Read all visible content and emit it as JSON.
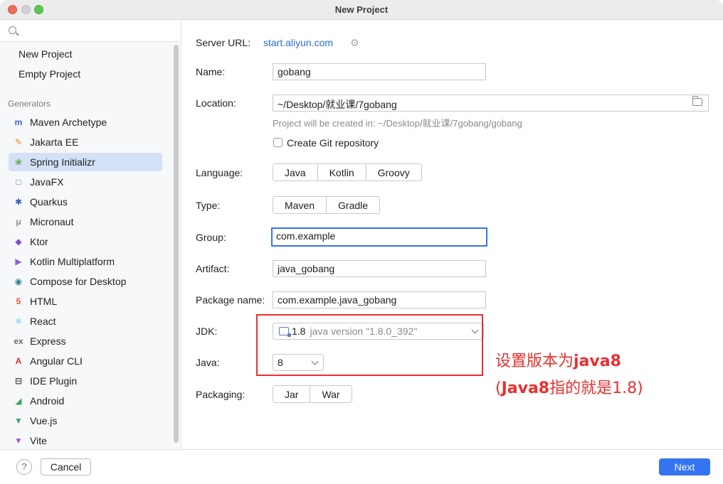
{
  "window": {
    "title": "New Project"
  },
  "sidebar": {
    "search_placeholder": "",
    "top_items": [
      {
        "label": "New Project"
      },
      {
        "label": "Empty Project"
      }
    ],
    "section_label": "Generators",
    "generators": [
      {
        "label": "Maven Archetype",
        "icon": "maven-icon",
        "glyph": "m",
        "color": "#3b5fc4"
      },
      {
        "label": "Jakarta EE",
        "icon": "jakarta-icon",
        "glyph": "✎",
        "color": "#e88b1e"
      },
      {
        "label": "Spring Initializr",
        "icon": "spring-icon",
        "glyph": "❀",
        "color": "#5fa845"
      },
      {
        "label": "JavaFX",
        "icon": "javafx-icon",
        "glyph": "□",
        "color": "#5a7fb8"
      },
      {
        "label": "Quarkus",
        "icon": "quarkus-icon",
        "glyph": "✱",
        "color": "#2f5fb0"
      },
      {
        "label": "Micronaut",
        "icon": "micronaut-icon",
        "glyph": "μ",
        "color": "#8a8a8a"
      },
      {
        "label": "Ktor",
        "icon": "ktor-icon",
        "glyph": "◆",
        "color": "#7b4fd8"
      },
      {
        "label": "Kotlin Multiplatform",
        "icon": "kotlin-icon",
        "glyph": "▶",
        "color": "#8e5ce6"
      },
      {
        "label": "Compose for Desktop",
        "icon": "compose-icon",
        "glyph": "◉",
        "color": "#2f7f8c"
      },
      {
        "label": "HTML",
        "icon": "html-icon",
        "glyph": "5",
        "color": "#e4572e"
      },
      {
        "label": "React",
        "icon": "react-icon",
        "glyph": "⚛",
        "color": "#3fb6d8"
      },
      {
        "label": "Express",
        "icon": "express-icon",
        "glyph": "ex",
        "color": "#6b6b6b"
      },
      {
        "label": "Angular CLI",
        "icon": "angular-icon",
        "glyph": "A",
        "color": "#d8303a"
      },
      {
        "label": "IDE Plugin",
        "icon": "plugin-icon",
        "glyph": "⊟",
        "color": "#4a4a4a"
      },
      {
        "label": "Android",
        "icon": "android-icon",
        "glyph": "◢",
        "color": "#3ba55c"
      },
      {
        "label": "Vue.js",
        "icon": "vue-icon",
        "glyph": "▼",
        "color": "#3fa776"
      },
      {
        "label": "Vite",
        "icon": "vite-icon",
        "glyph": "▼",
        "color": "#9b5de5"
      }
    ]
  },
  "form": {
    "server_url_label": "Server URL:",
    "server_url_value": "start.aliyun.com",
    "name_label": "Name:",
    "name_value": "gobang",
    "location_label": "Location:",
    "location_value": "~/Desktop/就业课/7gobang",
    "location_hint": "Project will be created in: ~/Desktop/就业课/7gobang/gobang",
    "git_label": "Create Git repository",
    "language_label": "Language:",
    "language_options": [
      "Java",
      "Kotlin",
      "Groovy"
    ],
    "type_label": "Type:",
    "type_options": [
      "Maven",
      "Gradle"
    ],
    "group_label": "Group:",
    "group_value": "com.example",
    "artifact_label": "Artifact:",
    "artifact_value": "java_gobang",
    "package_label": "Package name:",
    "package_value": "com.example.java_gobang",
    "jdk_label": "JDK:",
    "jdk_version": "1.8",
    "jdk_desc": "java version \"1.8.0_392\"",
    "java_label": "Java:",
    "java_value": "8",
    "packaging_label": "Packaging:",
    "packaging_options": [
      "Jar",
      "War"
    ]
  },
  "annotation": {
    "line1_prefix": "设置版本为",
    "line1_bold": "java8",
    "line2_open": "(",
    "line2_bold": "Java8",
    "line2_rest": "指的就是1.8)"
  },
  "footer": {
    "help_glyph": "?",
    "cancel_label": "Cancel",
    "next_label": "Next"
  }
}
